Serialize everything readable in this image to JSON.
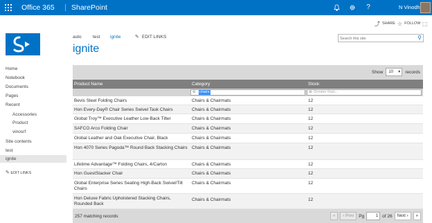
{
  "suitebar": {
    "app_name": "Office 365",
    "product": "SharePoint",
    "user": "N Vinodh",
    "icons": [
      "waffle-icon",
      "bell-icon",
      "gear-icon",
      "help-icon"
    ],
    "color": "#0072c6"
  },
  "actions": {
    "share": "SHARE",
    "follow": "FOLLOW"
  },
  "topnav": {
    "items": [
      "auto",
      "test",
      "ignite"
    ],
    "active": "ignite",
    "edit_links": "EDIT LINKS"
  },
  "page": {
    "title": "ignite"
  },
  "search": {
    "placeholder": "Search this site"
  },
  "leftnav": {
    "items": [
      {
        "label": "Home"
      },
      {
        "label": "Notebook"
      },
      {
        "label": "Documents"
      },
      {
        "label": "Pages"
      },
      {
        "label": "Recent"
      },
      {
        "label": "Accessories",
        "sub": true
      },
      {
        "label": "Product",
        "sub": true
      },
      {
        "label": "vinosrf",
        "sub": true
      },
      {
        "label": "Site contents"
      },
      {
        "label": "test"
      },
      {
        "label": "ignite",
        "selected": true
      }
    ],
    "edit_links": "EDIT LINKS"
  },
  "grid": {
    "show_label": "Show",
    "show_value": "10",
    "records_label": "records",
    "columns": [
      "Product Name",
      "Category",
      "Stock"
    ],
    "filters": {
      "category_value": "chairs",
      "stock_placeholder": "Greater than..."
    },
    "rows": [
      {
        "name": "Bevis Steel Folding Chairs",
        "category": "Chairs & Chairmats",
        "stock": "12"
      },
      {
        "name": "Hon Every-Day® Chair Series Swivel Task Chairs",
        "category": "Chairs & Chairmats",
        "stock": "12"
      },
      {
        "name": "Global Troy™ Executive Leather Low-Back Tilter",
        "category": "Chairs & Chairmats",
        "stock": "12"
      },
      {
        "name": "SAFCO Arco Folding Chair",
        "category": "Chairs & Chairmats",
        "stock": "12"
      },
      {
        "name": "Global Leather and Oak Executive Chair, Black",
        "category": "Chairs & Chairmats",
        "stock": "12"
      },
      {
        "name": "Hon 4070 Series Pagoda™ Round Back Stacking Chairs",
        "category": "Chairs & Chairmats",
        "stock": "12"
      },
      {
        "name": "Lifetime Advantage™ Folding Chairs, 4/Carton",
        "category": "Chairs & Chairmats",
        "stock": "12"
      },
      {
        "name": "Hon GuestStacker Chair",
        "category": "Chairs & Chairmats",
        "stock": "12"
      },
      {
        "name": "Global Enterprise Series Seating High-Back Swivel/Tilt Chairs",
        "category": "Chairs & Chairmats",
        "stock": "12"
      },
      {
        "name": "Hon Deluxe Fabric Upholstered Stacking Chairs, Rounded Back",
        "category": "Chairs & Chairmats",
        "stock": "12"
      }
    ],
    "footer": {
      "count": "257 matching records",
      "prev": "Prev",
      "page_label": "Pg",
      "page_value": "1",
      "of_label": "of 26",
      "next": "Next"
    }
  }
}
